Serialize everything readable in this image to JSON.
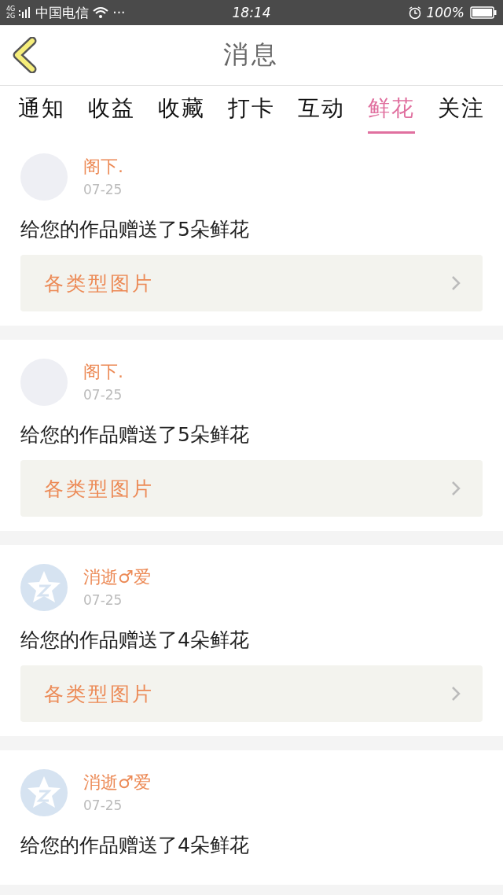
{
  "status_bar": {
    "network": [
      "4G",
      "2G"
    ],
    "carrier": "中国电信",
    "more": "···",
    "time": "18:14",
    "battery": "100%"
  },
  "header": {
    "title": "消息"
  },
  "tabs": [
    {
      "label": "通知",
      "selected": false
    },
    {
      "label": "收益",
      "selected": false
    },
    {
      "label": "收藏",
      "selected": false
    },
    {
      "label": "打卡",
      "selected": false
    },
    {
      "label": "互动",
      "selected": false
    },
    {
      "label": "鲜花",
      "selected": true
    },
    {
      "label": "关注",
      "selected": false
    }
  ],
  "messages": [
    {
      "avatar": {
        "kind": "plain"
      },
      "name": "阁下.",
      "date": "07-25",
      "text": "给您的作品赠送了5朵鲜花",
      "link": "各类型图片"
    },
    {
      "avatar": {
        "kind": "plain"
      },
      "name": "阁下.",
      "date": "07-25",
      "text": "给您的作品赠送了5朵鲜花",
      "link": "各类型图片"
    },
    {
      "avatar": {
        "kind": "star"
      },
      "name": "消逝♂爱",
      "date": "07-25",
      "text": "给您的作品赠送了4朵鲜花",
      "link": "各类型图片"
    },
    {
      "avatar": {
        "kind": "star"
      },
      "name": "消逝♂爱",
      "date": "07-25",
      "text": "给您的作品赠送了4朵鲜花"
    }
  ]
}
